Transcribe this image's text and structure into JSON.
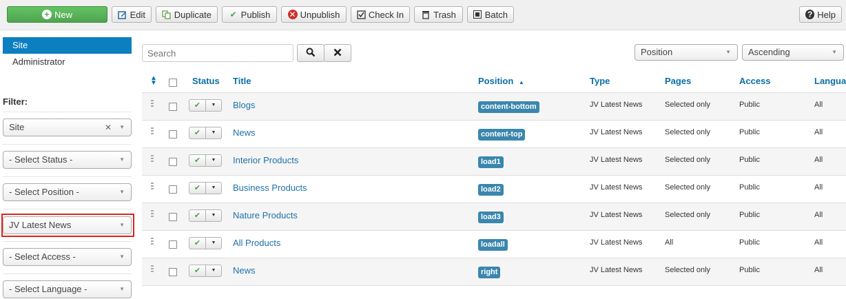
{
  "toolbar": {
    "new": "New",
    "edit": "Edit",
    "duplicate": "Duplicate",
    "publish": "Publish",
    "unpublish": "Unpublish",
    "checkin": "Check In",
    "trash": "Trash",
    "batch": "Batch",
    "help": "Help"
  },
  "sidebar": {
    "items": [
      {
        "label": "Site",
        "active": true
      },
      {
        "label": "Administrator",
        "active": false
      }
    ],
    "filter_label": "Filter:",
    "filters": {
      "client": "Site",
      "status": "- Select Status -",
      "position": "- Select Position -",
      "module": "JV Latest News",
      "access": "- Select Access -",
      "language": "- Select Language -"
    }
  },
  "search": {
    "placeholder": "Search"
  },
  "sort": {
    "field": "Position",
    "direction": "Ascending"
  },
  "table": {
    "headers": {
      "status": "Status",
      "title": "Title",
      "position": "Position",
      "type": "Type",
      "pages": "Pages",
      "access": "Access",
      "language": "Langua"
    },
    "rows": [
      {
        "title": "Blogs",
        "position": "content-bottom",
        "type": "JV Latest News",
        "pages": "Selected only",
        "access": "Public",
        "language": "All"
      },
      {
        "title": "News",
        "position": "content-top",
        "type": "JV Latest News",
        "pages": "Selected only",
        "access": "Public",
        "language": "All"
      },
      {
        "title": "Interior Products",
        "position": "load1",
        "type": "JV Latest News",
        "pages": "Selected only",
        "access": "Public",
        "language": "All"
      },
      {
        "title": "Business Products",
        "position": "load2",
        "type": "JV Latest News",
        "pages": "Selected only",
        "access": "Public",
        "language": "All"
      },
      {
        "title": "Nature Products",
        "position": "load3",
        "type": "JV Latest News",
        "pages": "Selected only",
        "access": "Public",
        "language": "All"
      },
      {
        "title": "All Products",
        "position": "loadall",
        "type": "JV Latest News",
        "pages": "All",
        "access": "Public",
        "language": "All"
      },
      {
        "title": "News",
        "position": "right",
        "type": "JV Latest News",
        "pages": "Selected only",
        "access": "Public",
        "language": "All"
      }
    ]
  }
}
